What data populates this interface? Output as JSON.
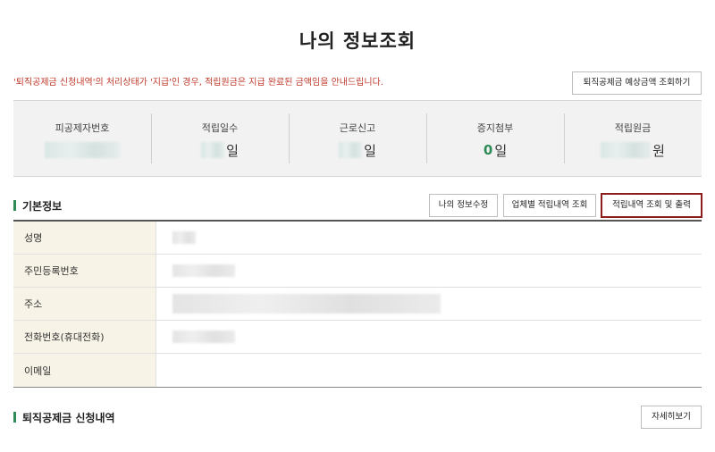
{
  "page": {
    "title": "나의 정보조회"
  },
  "notice": {
    "text": "'퇴직공제금 신청내역'의 처리상태가 '지급'인 경우, 적립원금은 지급 완료된 금액임을 안내드립니다."
  },
  "buttons": {
    "estimate": "퇴직공제금 예상금액 조회하기",
    "my_info_edit": "나의 정보수정",
    "company_history": "업체별 적립내역 조회",
    "history_print": "적립내역 조회 및 출력",
    "view_detail": "자세히보기"
  },
  "stats": [
    {
      "label": "피공제자번호",
      "unit": ""
    },
    {
      "label": "적립일수",
      "unit": "일"
    },
    {
      "label": "근로신고",
      "unit": "일"
    },
    {
      "label": "증지첨부",
      "value": "0",
      "unit": "일"
    },
    {
      "label": "적립원금",
      "unit": "원"
    }
  ],
  "basic_info": {
    "title": "기본정보",
    "rows": [
      {
        "label": "성명"
      },
      {
        "label": "주민등록번호"
      },
      {
        "label": "주소"
      },
      {
        "label": "전화번호(휴대전화)"
      },
      {
        "label": "이메일"
      }
    ]
  },
  "retirement": {
    "title": "퇴직공제금 신청내역"
  },
  "colors": {
    "accent_green": "#2e8b57",
    "notice_red": "#c0392b",
    "print_border": "#8b1d1d",
    "table_head_bg": "#f7f3e6"
  }
}
